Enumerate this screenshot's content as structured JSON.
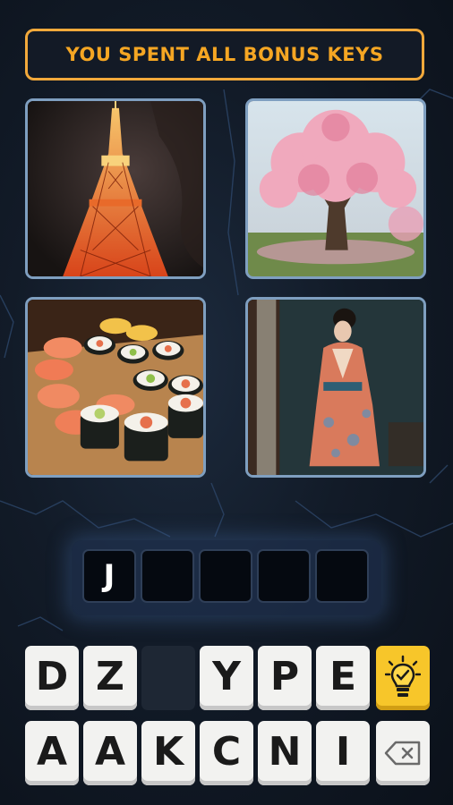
{
  "banner": {
    "text": "YOU SPENT ALL BONUS KEYS"
  },
  "colors": {
    "accent": "#f5a623",
    "tile_border": "#7f9fc0",
    "hint_bg": "#f7c62a"
  },
  "images": [
    {
      "name": "tokyo-tower-photo"
    },
    {
      "name": "cherry-blossom-tree-photo"
    },
    {
      "name": "sushi-rolls-photo"
    },
    {
      "name": "woman-in-kimono-photo"
    }
  ],
  "answer": {
    "slots": [
      "J",
      "",
      "",
      "",
      ""
    ]
  },
  "keyboard": {
    "row1": [
      "D",
      "Z",
      "",
      "Y",
      "P",
      "E"
    ],
    "row2": [
      "A",
      "A",
      "K",
      "C",
      "N",
      "I"
    ]
  },
  "icons": {
    "hint": "lightbulb-icon",
    "delete": "backspace-icon"
  }
}
